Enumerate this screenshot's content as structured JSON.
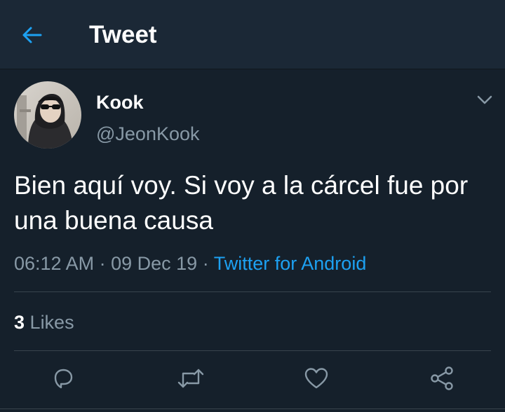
{
  "header": {
    "back_icon": "arrow-left-icon",
    "title": "Tweet"
  },
  "tweet": {
    "author": {
      "display_name": "Kook",
      "handle": "@JeonKook"
    },
    "text": "Bien aquí voy. Si voy a la cárcel fue por una buena causa",
    "time": "06:12 AM",
    "separator": "·",
    "date": "09 Dec 19",
    "source": "Twitter for Android",
    "likes_count": "3",
    "likes_label": "Likes"
  },
  "actions": [
    "reply-icon",
    "retweet-icon",
    "like-icon",
    "share-icon"
  ],
  "colors": {
    "background": "#15202b",
    "header_background": "#1b2836",
    "accent": "#1da1f2",
    "secondary_text": "#8899a6",
    "divider": "#38444d"
  }
}
